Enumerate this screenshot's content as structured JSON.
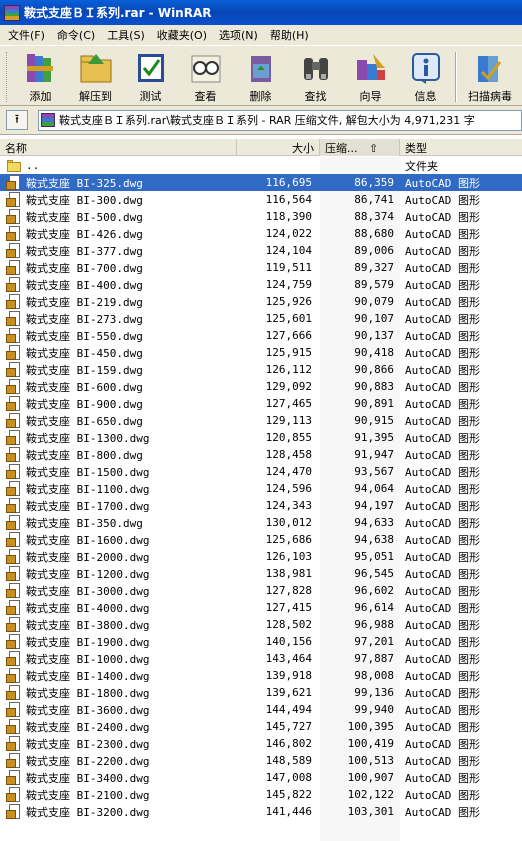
{
  "window": {
    "title": "鞍式支座ＢＩ系列.rar - WinRAR"
  },
  "menu": [
    "文件(F)",
    "命令(C)",
    "工具(S)",
    "收藏夹(O)",
    "选项(N)",
    "帮助(H)"
  ],
  "toolbar": {
    "buttons": [
      {
        "label": "添加",
        "icon": "add-books-icon"
      },
      {
        "label": "解压到",
        "icon": "extract-folder-icon"
      },
      {
        "label": "测试",
        "icon": "test-check-icon"
      },
      {
        "label": "查看",
        "icon": "view-glasses-icon"
      },
      {
        "label": "删除",
        "icon": "delete-recycle-icon"
      },
      {
        "label": "查找",
        "icon": "find-binoculars-icon"
      },
      {
        "label": "向导",
        "icon": "wizard-icon"
      },
      {
        "label": "信息",
        "icon": "info-icon"
      },
      {
        "label": "扫描病毒",
        "icon": "virus-scan-icon"
      }
    ]
  },
  "address": {
    "text": "鞍式支座ＢＩ系列.rar\\鞍式支座ＢＩ系列 - RAR 压缩文件, 解包大小为 4,971,231 字"
  },
  "columns": {
    "name": "名称",
    "size": "大小",
    "packed": "压缩...",
    "type": "类型"
  },
  "parent_row": {
    "name": "..",
    "type": "文件夹"
  },
  "files": [
    {
      "name": "鞍式支座 BI-325.dwg",
      "size": "116,695",
      "packed": "86,359",
      "type": "AutoCAD 图形"
    },
    {
      "name": "鞍式支座 BI-300.dwg",
      "size": "116,564",
      "packed": "86,741",
      "type": "AutoCAD 图形"
    },
    {
      "name": "鞍式支座 BI-500.dwg",
      "size": "118,390",
      "packed": "88,374",
      "type": "AutoCAD 图形"
    },
    {
      "name": "鞍式支座 BI-426.dwg",
      "size": "124,022",
      "packed": "88,680",
      "type": "AutoCAD 图形"
    },
    {
      "name": "鞍式支座 BI-377.dwg",
      "size": "124,104",
      "packed": "89,006",
      "type": "AutoCAD 图形"
    },
    {
      "name": "鞍式支座 BI-700.dwg",
      "size": "119,511",
      "packed": "89,327",
      "type": "AutoCAD 图形"
    },
    {
      "name": "鞍式支座 BI-400.dwg",
      "size": "124,759",
      "packed": "89,579",
      "type": "AutoCAD 图形"
    },
    {
      "name": "鞍式支座 BI-219.dwg",
      "size": "125,926",
      "packed": "90,079",
      "type": "AutoCAD 图形"
    },
    {
      "name": "鞍式支座 BI-273.dwg",
      "size": "125,601",
      "packed": "90,107",
      "type": "AutoCAD 图形"
    },
    {
      "name": "鞍式支座 BI-550.dwg",
      "size": "127,666",
      "packed": "90,137",
      "type": "AutoCAD 图形"
    },
    {
      "name": "鞍式支座 BI-450.dwg",
      "size": "125,915",
      "packed": "90,418",
      "type": "AutoCAD 图形"
    },
    {
      "name": "鞍式支座 BI-159.dwg",
      "size": "126,112",
      "packed": "90,866",
      "type": "AutoCAD 图形"
    },
    {
      "name": "鞍式支座 BI-600.dwg",
      "size": "129,092",
      "packed": "90,883",
      "type": "AutoCAD 图形"
    },
    {
      "name": "鞍式支座 BI-900.dwg",
      "size": "127,465",
      "packed": "90,891",
      "type": "AutoCAD 图形"
    },
    {
      "name": "鞍式支座 BI-650.dwg",
      "size": "129,113",
      "packed": "90,915",
      "type": "AutoCAD 图形"
    },
    {
      "name": "鞍式支座 BI-1300.dwg",
      "size": "120,855",
      "packed": "91,395",
      "type": "AutoCAD 图形"
    },
    {
      "name": "鞍式支座 BI-800.dwg",
      "size": "128,458",
      "packed": "91,947",
      "type": "AutoCAD 图形"
    },
    {
      "name": "鞍式支座 BI-1500.dwg",
      "size": "124,470",
      "packed": "93,567",
      "type": "AutoCAD 图形"
    },
    {
      "name": "鞍式支座 BI-1100.dwg",
      "size": "124,596",
      "packed": "94,064",
      "type": "AutoCAD 图形"
    },
    {
      "name": "鞍式支座 BI-1700.dwg",
      "size": "124,343",
      "packed": "94,197",
      "type": "AutoCAD 图形"
    },
    {
      "name": "鞍式支座 BI-350.dwg",
      "size": "130,012",
      "packed": "94,633",
      "type": "AutoCAD 图形"
    },
    {
      "name": "鞍式支座 BI-1600.dwg",
      "size": "125,686",
      "packed": "94,638",
      "type": "AutoCAD 图形"
    },
    {
      "name": "鞍式支座 BI-2000.dwg",
      "size": "126,103",
      "packed": "95,051",
      "type": "AutoCAD 图形"
    },
    {
      "name": "鞍式支座 BI-1200.dwg",
      "size": "138,981",
      "packed": "96,545",
      "type": "AutoCAD 图形"
    },
    {
      "name": "鞍式支座 BI-3000.dwg",
      "size": "127,828",
      "packed": "96,602",
      "type": "AutoCAD 图形"
    },
    {
      "name": "鞍式支座 BI-4000.dwg",
      "size": "127,415",
      "packed": "96,614",
      "type": "AutoCAD 图形"
    },
    {
      "name": "鞍式支座 BI-3800.dwg",
      "size": "128,502",
      "packed": "96,988",
      "type": "AutoCAD 图形"
    },
    {
      "name": "鞍式支座 BI-1900.dwg",
      "size": "140,156",
      "packed": "97,201",
      "type": "AutoCAD 图形"
    },
    {
      "name": "鞍式支座 BI-1000.dwg",
      "size": "143,464",
      "packed": "97,887",
      "type": "AutoCAD 图形"
    },
    {
      "name": "鞍式支座 BI-1400.dwg",
      "size": "139,918",
      "packed": "98,008",
      "type": "AutoCAD 图形"
    },
    {
      "name": "鞍式支座 BI-1800.dwg",
      "size": "139,621",
      "packed": "99,136",
      "type": "AutoCAD 图形"
    },
    {
      "name": "鞍式支座 BI-3600.dwg",
      "size": "144,494",
      "packed": "99,940",
      "type": "AutoCAD 图形"
    },
    {
      "name": "鞍式支座 BI-2400.dwg",
      "size": "145,727",
      "packed": "100,395",
      "type": "AutoCAD 图形"
    },
    {
      "name": "鞍式支座 BI-2300.dwg",
      "size": "146,802",
      "packed": "100,419",
      "type": "AutoCAD 图形"
    },
    {
      "name": "鞍式支座 BI-2200.dwg",
      "size": "148,589",
      "packed": "100,513",
      "type": "AutoCAD 图形"
    },
    {
      "name": "鞍式支座 BI-3400.dwg",
      "size": "147,008",
      "packed": "100,907",
      "type": "AutoCAD 图形"
    },
    {
      "name": "鞍式支座 BI-2100.dwg",
      "size": "145,822",
      "packed": "102,122",
      "type": "AutoCAD 图形"
    },
    {
      "name": "鞍式支座 BI-3200.dwg",
      "size": "141,446",
      "packed": "103,301",
      "type": "AutoCAD 图形"
    }
  ],
  "selected_index": 0,
  "colors": {
    "titlebar": "#0646b6",
    "selection": "#316ac5",
    "chrome": "#ece9d8"
  }
}
